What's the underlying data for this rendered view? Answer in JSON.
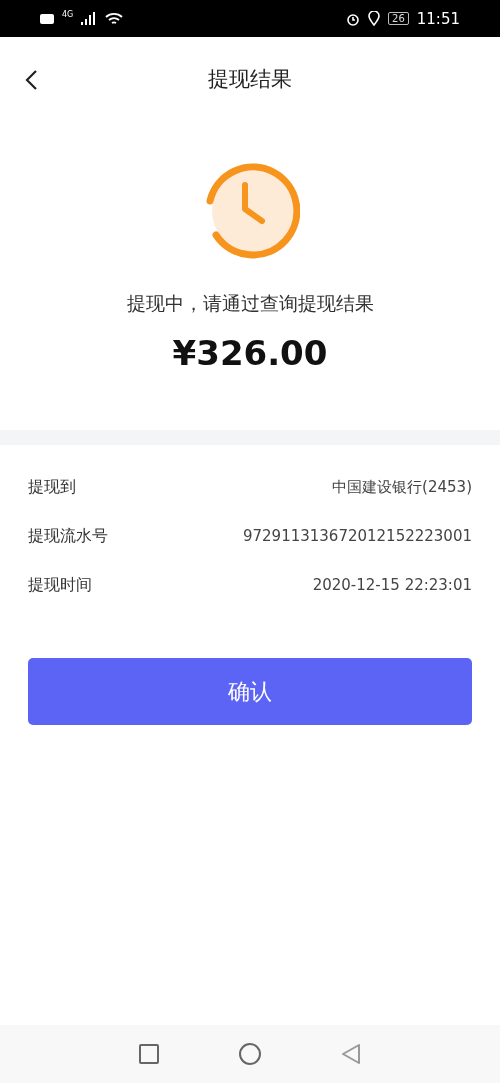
{
  "status_bar": {
    "network": "4G",
    "battery": "26",
    "time": "11:51"
  },
  "header": {
    "title": "提现结果"
  },
  "result": {
    "message": "提现中，请通过查询提现结果",
    "amount": "¥326.00"
  },
  "details": [
    {
      "label": "提现到",
      "value": "中国建设银行(2453)"
    },
    {
      "label": "提现流水号",
      "value": "972911313672012152223001"
    },
    {
      "label": "提现时间",
      "value": "2020-12-15 22:23:01"
    }
  ],
  "confirm_button": "确认"
}
